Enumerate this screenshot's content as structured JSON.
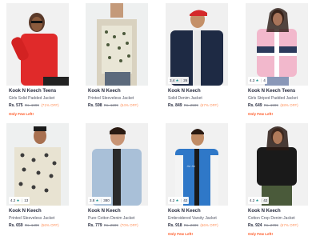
{
  "products": [
    {
      "brand": "Kook N Keech Teens",
      "name": "Girls Solid Padded Jacket",
      "price": "Rs. 575",
      "mrp": "Rs. 1999",
      "discount": "(71% OFF)",
      "stock_note": "Only Few Left!",
      "rating": "",
      "rating_count": ""
    },
    {
      "brand": "Kook N Keech",
      "name": "Printed Sleeveless Jacket",
      "price": "Rs. 598",
      "mrp": "Rs. 1299",
      "discount": "(54% OFF)",
      "stock_note": "",
      "rating": "",
      "rating_count": ""
    },
    {
      "brand": "Kook N Keech",
      "name": "Solid Denim Jacket",
      "price": "Rs. 849",
      "mrp": "Rs. 2599",
      "discount": "(67% OFF)",
      "stock_note": "",
      "rating": "3.4",
      "rating_count": "26"
    },
    {
      "brand": "Kook N Keech Teens",
      "name": "Girls Striped Padded Jacket",
      "price": "Rs. 649",
      "mrp": "Rs. 1999",
      "discount": "(68% OFF)",
      "stock_note": "Only Few Left!",
      "rating": "4.3",
      "rating_count": "4"
    },
    {
      "brand": "Kook N Keech",
      "name": "Printed Sleeveless Jacket",
      "price": "Rs. 659",
      "mrp": "Rs. 1499",
      "discount": "(56% OFF)",
      "stock_note": "",
      "rating": "4.2",
      "rating_count": "13"
    },
    {
      "brand": "Kook N Keech",
      "name": "Pure Cotton Denim Jacket",
      "price": "Rs. 779",
      "mrp": "Rs. 2599",
      "discount": "(70% OFF)",
      "stock_note": "",
      "rating": "3.8",
      "rating_count": "380"
    },
    {
      "brand": "Kook N Keech",
      "name": "Embroidered Varsity Jacket",
      "price": "Rs. 918",
      "mrp": "Rs. 2699",
      "discount": "(66% OFF)",
      "stock_note": "Only Few Left!",
      "rating": "4.2",
      "rating_count": "42"
    },
    {
      "brand": "Kook N Keech",
      "name": "Cotton Crop Denim Jacket",
      "price": "Rs. 924",
      "mrp": "Rs. 2799",
      "discount": "(67% OFF)",
      "stock_note": "Only Few Left!",
      "rating": "4.2",
      "rating_count": "42"
    }
  ],
  "colors": {
    "rating_star": "#14958f",
    "discount": "#ff905a",
    "stock_note": "#ff5722"
  }
}
